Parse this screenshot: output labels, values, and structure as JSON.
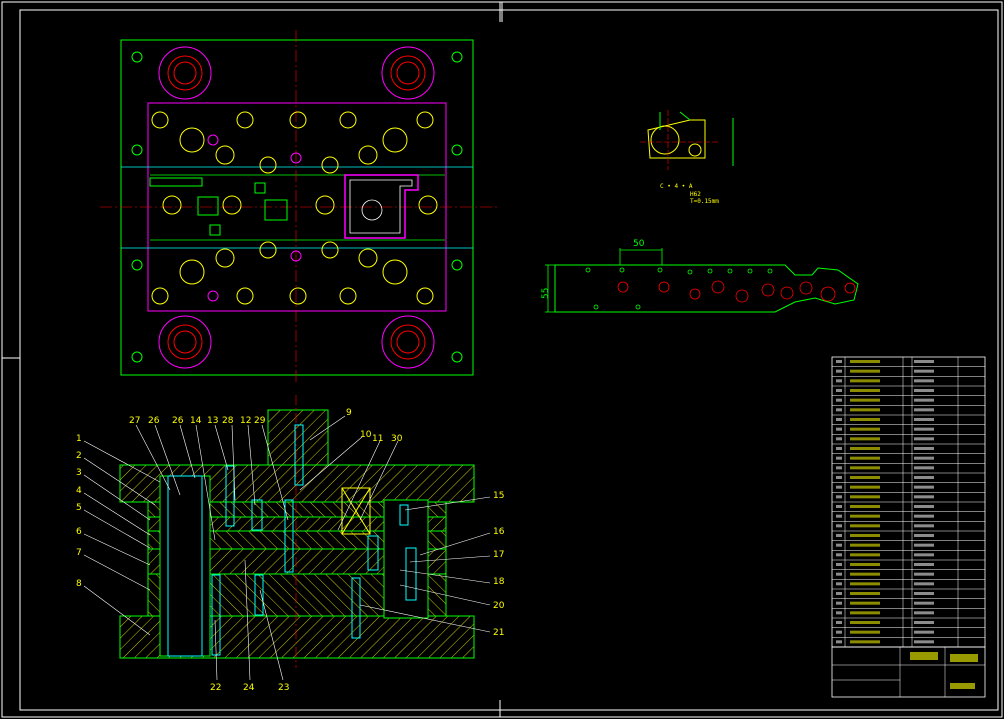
{
  "colors": {
    "background": "#000000",
    "frame": "#ffffff",
    "outline": "#00ff00",
    "hatch": "#ffff00",
    "hole": "#ff0000",
    "center": "#ff0000",
    "cyan": "#00ffff",
    "magenta": "#ff00ff",
    "label": "#ffff00"
  },
  "part_labels_left": [
    "1",
    "2",
    "3",
    "4",
    "5",
    "6",
    "7",
    "8"
  ],
  "part_labels_top": [
    "27",
    "26",
    "14",
    "13",
    "28",
    "12",
    "29",
    "9",
    "10",
    "11",
    "30"
  ],
  "part_labels_right": [
    "15",
    "16",
    "17",
    "18",
    "20",
    "21"
  ],
  "part_labels_bottom": [
    "22",
    "24",
    "23"
  ],
  "strip": {
    "pitch_label": "50",
    "width_label": "55"
  },
  "part_notes": {
    "line1": "C  •  4  •  A",
    "line2": "H62",
    "line3": "T=0.15mm"
  },
  "title_block": {
    "drawing_name": "",
    "school": ""
  }
}
